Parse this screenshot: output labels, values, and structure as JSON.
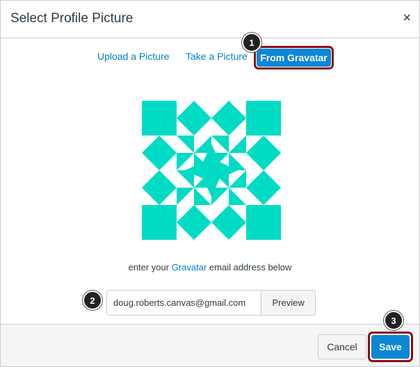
{
  "dialog": {
    "title": "Select Profile Picture",
    "close_glyph": "×"
  },
  "tabs": [
    {
      "label": "Upload a Picture"
    },
    {
      "label": "Take a Picture"
    },
    {
      "label": "From Gravatar",
      "active": true
    }
  ],
  "callouts": [
    "1",
    "2",
    "3"
  ],
  "identicon": {
    "color": "#00dcc4",
    "icon": "gravatar-identicon"
  },
  "hint": {
    "before": "enter your ",
    "link": "Gravatar",
    "after": " email address below"
  },
  "email": {
    "value": "doug.roberts.canvas@gmail.com",
    "preview_label": "Preview"
  },
  "footer": {
    "cancel_label": "Cancel",
    "save_label": "Save"
  },
  "colors": {
    "accent": "#0c87d6",
    "link": "#0081c6",
    "highlight": "#8e0b14"
  }
}
